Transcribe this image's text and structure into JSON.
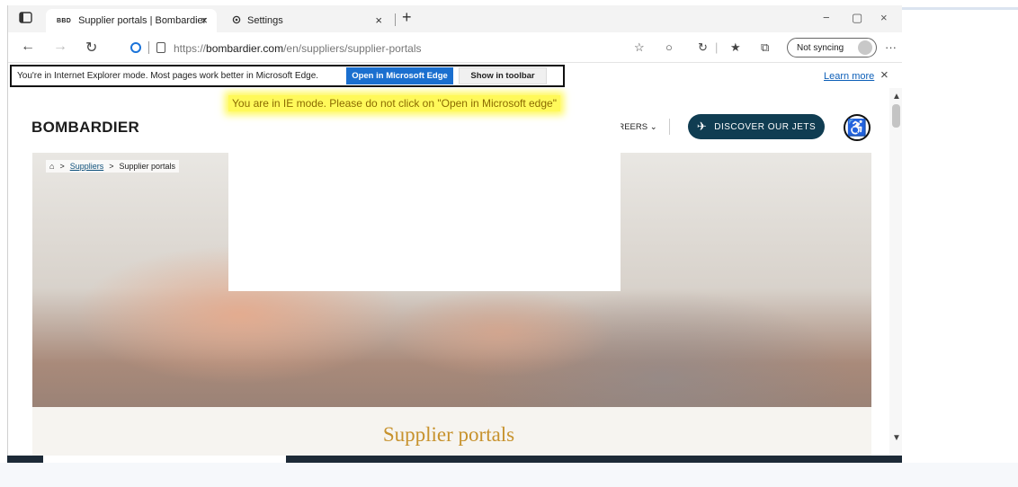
{
  "browser": {
    "tabs": [
      {
        "favicon_text": "BBD",
        "label": "Supplier portals | Bombardier",
        "close": "×"
      },
      {
        "favicon_icon": "gear-icon",
        "label": "Settings",
        "close": "×"
      }
    ],
    "new_tab": "+",
    "window_controls": {
      "minimize": "−",
      "maximize": "▢",
      "close": "×"
    },
    "url_prefix": "https://",
    "url_domain": "bombardier.com",
    "url_path": "/en/suppliers/supplier-portals",
    "sync_label": "Not syncing",
    "more": "···"
  },
  "ie_bar": {
    "message": "You're in Internet Explorer mode. Most pages work better in Microsoft Edge.",
    "open_edge_label": "Open in Microsoft Edge",
    "show_toolbar_label": "Show in toolbar",
    "learn_more": "Learn more",
    "close": "×"
  },
  "annotation": "You are in IE mode. Please do not click on \"Open in Microsoft edge\"",
  "site": {
    "logo": "BOMBARDIER",
    "nav_careers": "AREERS",
    "discover_button": "DISCOVER OUR JETS",
    "breadcrumb": {
      "home_icon": "home-icon",
      "sep": ">",
      "suppliers": "Suppliers",
      "current": "Supplier portals"
    },
    "page_title": "Supplier portals"
  },
  "colors": {
    "accent_blue": "#1a6fcf",
    "discover_bg": "#103d52",
    "title_gold": "#c7922d",
    "highlight": "#fff95a"
  }
}
